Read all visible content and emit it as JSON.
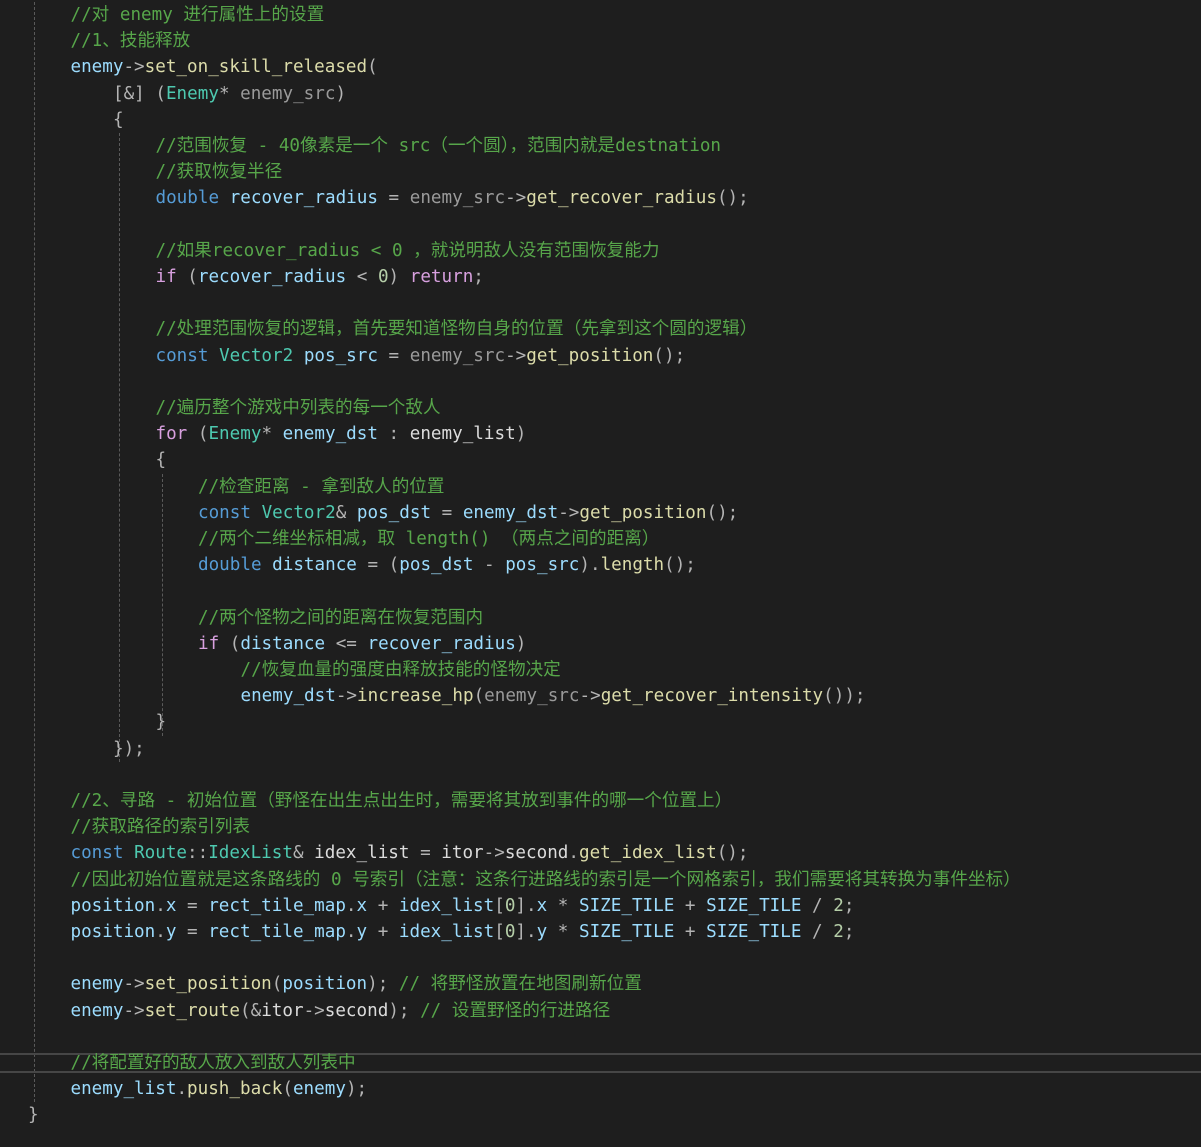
{
  "editor": {
    "theme_colors": {
      "background": "#1e1e1e",
      "comment": "#57a64a",
      "keyword": "#569cd6",
      "control": "#d8a0df",
      "type": "#4ec9b0",
      "function": "#dcdcaa",
      "variable": "#9cdcfe",
      "parameter": "#9a9a9a",
      "number": "#b5cea8",
      "macro": "#bd63c5",
      "identifier": "#dcdcdc",
      "punctuation": "#b4b4b4"
    },
    "lines": [
      {
        "indent": 1,
        "tokens": [
          {
            "t": "//对 enemy 进行属性上的设置",
            "k": "comment"
          }
        ]
      },
      {
        "indent": 1,
        "tokens": [
          {
            "t": "//1、技能释放",
            "k": "comment"
          }
        ]
      },
      {
        "indent": 1,
        "tokens": [
          {
            "t": "enemy",
            "k": "var"
          },
          {
            "t": "->",
            "k": "punct"
          },
          {
            "t": "set_on_skill_released",
            "k": "func"
          },
          {
            "t": "(",
            "k": "punct"
          }
        ]
      },
      {
        "indent": 2,
        "tokens": [
          {
            "t": "[&] (",
            "k": "punct"
          },
          {
            "t": "Enemy",
            "k": "type"
          },
          {
            "t": "* ",
            "k": "punct"
          },
          {
            "t": "enemy_src",
            "k": "param"
          },
          {
            "t": ")",
            "k": "punct"
          }
        ]
      },
      {
        "indent": 2,
        "tokens": [
          {
            "t": "{",
            "k": "punct"
          }
        ]
      },
      {
        "indent": 3,
        "tokens": [
          {
            "t": "//范围恢复 - 40像素是一个 src（一个圆），范围内就是destnation",
            "k": "comment"
          }
        ]
      },
      {
        "indent": 3,
        "tokens": [
          {
            "t": "//获取恢复半径",
            "k": "comment"
          }
        ]
      },
      {
        "indent": 3,
        "tokens": [
          {
            "t": "double",
            "k": "keyword"
          },
          {
            "t": " ",
            "k": "punct"
          },
          {
            "t": "recover_radius",
            "k": "var"
          },
          {
            "t": " = ",
            "k": "punct"
          },
          {
            "t": "enemy_src",
            "k": "param"
          },
          {
            "t": "->",
            "k": "punct"
          },
          {
            "t": "get_recover_radius",
            "k": "func"
          },
          {
            "t": "();",
            "k": "punct"
          }
        ]
      },
      {
        "indent": 3,
        "tokens": []
      },
      {
        "indent": 3,
        "tokens": [
          {
            "t": "//如果recover_radius < 0 ，就说明敌人没有范围恢复能力",
            "k": "comment"
          }
        ]
      },
      {
        "indent": 3,
        "tokens": [
          {
            "t": "if",
            "k": "control"
          },
          {
            "t": " (",
            "k": "punct"
          },
          {
            "t": "recover_radius",
            "k": "var"
          },
          {
            "t": " < ",
            "k": "punct"
          },
          {
            "t": "0",
            "k": "number"
          },
          {
            "t": ") ",
            "k": "punct"
          },
          {
            "t": "return",
            "k": "control"
          },
          {
            "t": ";",
            "k": "punct"
          }
        ]
      },
      {
        "indent": 3,
        "tokens": []
      },
      {
        "indent": 3,
        "tokens": [
          {
            "t": "//处理范围恢复的逻辑，首先要知道怪物自身的位置（先拿到这个圆的逻辑）",
            "k": "comment"
          }
        ]
      },
      {
        "indent": 3,
        "tokens": [
          {
            "t": "const",
            "k": "keyword"
          },
          {
            "t": " ",
            "k": "punct"
          },
          {
            "t": "Vector2",
            "k": "type"
          },
          {
            "t": " ",
            "k": "punct"
          },
          {
            "t": "pos_src",
            "k": "var"
          },
          {
            "t": " = ",
            "k": "punct"
          },
          {
            "t": "enemy_src",
            "k": "param"
          },
          {
            "t": "->",
            "k": "punct"
          },
          {
            "t": "get_position",
            "k": "func"
          },
          {
            "t": "();",
            "k": "punct"
          }
        ]
      },
      {
        "indent": 3,
        "tokens": []
      },
      {
        "indent": 3,
        "tokens": [
          {
            "t": "//遍历整个游戏中列表的每一个敌人",
            "k": "comment"
          }
        ]
      },
      {
        "indent": 3,
        "tokens": [
          {
            "t": "for",
            "k": "control"
          },
          {
            "t": " (",
            "k": "punct"
          },
          {
            "t": "Enemy",
            "k": "type"
          },
          {
            "t": "* ",
            "k": "punct"
          },
          {
            "t": "enemy_dst",
            "k": "var"
          },
          {
            "t": " : ",
            "k": "punct"
          },
          {
            "t": "enemy_list",
            "k": "ident"
          },
          {
            "t": ")",
            "k": "punct"
          }
        ]
      },
      {
        "indent": 3,
        "tokens": [
          {
            "t": "{",
            "k": "punct"
          }
        ]
      },
      {
        "indent": 4,
        "tokens": [
          {
            "t": "//检查距离 - 拿到敌人的位置",
            "k": "comment"
          }
        ]
      },
      {
        "indent": 4,
        "tokens": [
          {
            "t": "const",
            "k": "keyword"
          },
          {
            "t": " ",
            "k": "punct"
          },
          {
            "t": "Vector2",
            "k": "type"
          },
          {
            "t": "& ",
            "k": "punct"
          },
          {
            "t": "pos_dst",
            "k": "var"
          },
          {
            "t": " = ",
            "k": "punct"
          },
          {
            "t": "enemy_dst",
            "k": "var"
          },
          {
            "t": "->",
            "k": "punct"
          },
          {
            "t": "get_position",
            "k": "func"
          },
          {
            "t": "();",
            "k": "punct"
          }
        ]
      },
      {
        "indent": 4,
        "tokens": [
          {
            "t": "//两个二维坐标相减，取 length() （两点之间的距离）",
            "k": "comment"
          }
        ]
      },
      {
        "indent": 4,
        "tokens": [
          {
            "t": "double",
            "k": "keyword"
          },
          {
            "t": " ",
            "k": "punct"
          },
          {
            "t": "distance",
            "k": "var"
          },
          {
            "t": " = (",
            "k": "punct"
          },
          {
            "t": "pos_dst",
            "k": "var"
          },
          {
            "t": " - ",
            "k": "punct"
          },
          {
            "t": "pos_src",
            "k": "var"
          },
          {
            "t": ").",
            "k": "punct"
          },
          {
            "t": "length",
            "k": "func"
          },
          {
            "t": "();",
            "k": "punct"
          }
        ]
      },
      {
        "indent": 4,
        "tokens": []
      },
      {
        "indent": 4,
        "tokens": [
          {
            "t": "//两个怪物之间的距离在恢复范围内",
            "k": "comment"
          }
        ]
      },
      {
        "indent": 4,
        "tokens": [
          {
            "t": "if",
            "k": "control"
          },
          {
            "t": " (",
            "k": "punct"
          },
          {
            "t": "distance",
            "k": "var"
          },
          {
            "t": " <= ",
            "k": "punct"
          },
          {
            "t": "recover_radius",
            "k": "var"
          },
          {
            "t": ")",
            "k": "punct"
          }
        ]
      },
      {
        "indent": 5,
        "tokens": [
          {
            "t": "//恢复血量的强度由释放技能的怪物决定",
            "k": "comment"
          }
        ]
      },
      {
        "indent": 5,
        "tokens": [
          {
            "t": "enemy_dst",
            "k": "var"
          },
          {
            "t": "->",
            "k": "punct"
          },
          {
            "t": "increase_hp",
            "k": "func"
          },
          {
            "t": "(",
            "k": "punct"
          },
          {
            "t": "enemy_src",
            "k": "param"
          },
          {
            "t": "->",
            "k": "punct"
          },
          {
            "t": "get_recover_intensity",
            "k": "func"
          },
          {
            "t": "());",
            "k": "punct"
          }
        ]
      },
      {
        "indent": 3,
        "tokens": [
          {
            "t": "}",
            "k": "punct"
          }
        ]
      },
      {
        "indent": 2,
        "tokens": [
          {
            "t": "});",
            "k": "punct"
          }
        ]
      },
      {
        "indent": 1,
        "tokens": []
      },
      {
        "indent": 1,
        "tokens": [
          {
            "t": "//2、寻路 - 初始位置（野怪在出生点出生时，需要将其放到事件的哪一个位置上）",
            "k": "comment"
          }
        ]
      },
      {
        "indent": 1,
        "tokens": [
          {
            "t": "//获取路径的索引列表",
            "k": "comment"
          }
        ]
      },
      {
        "indent": 1,
        "tokens": [
          {
            "t": "const",
            "k": "keyword"
          },
          {
            "t": " ",
            "k": "punct"
          },
          {
            "t": "Route",
            "k": "type"
          },
          {
            "t": "::",
            "k": "punct"
          },
          {
            "t": "IdexList",
            "k": "type"
          },
          {
            "t": "& ",
            "k": "punct"
          },
          {
            "t": "idex_list",
            "k": "ident"
          },
          {
            "t": " = ",
            "k": "punct"
          },
          {
            "t": "itor",
            "k": "ident"
          },
          {
            "t": "->",
            "k": "punct"
          },
          {
            "t": "second",
            "k": "ident"
          },
          {
            "t": ".",
            "k": "punct"
          },
          {
            "t": "get_idex_list",
            "k": "func"
          },
          {
            "t": "();",
            "k": "punct"
          }
        ]
      },
      {
        "indent": 1,
        "tokens": [
          {
            "t": "//因此初始位置就是这条路线的 0 号索引（注意：这条行进路线的索引是一个网格索引，我们需要将其转换为事件坐标）",
            "k": "comment"
          }
        ]
      },
      {
        "indent": 1,
        "tokens": [
          {
            "t": "position",
            "k": "var"
          },
          {
            "t": ".",
            "k": "punct"
          },
          {
            "t": "x",
            "k": "var"
          },
          {
            "t": " = ",
            "k": "punct"
          },
          {
            "t": "rect_tile_map",
            "k": "var"
          },
          {
            "t": ".",
            "k": "punct"
          },
          {
            "t": "x",
            "k": "var"
          },
          {
            "t": " + ",
            "k": "punct"
          },
          {
            "t": "idex_list",
            "k": "var"
          },
          {
            "t": "[",
            "k": "punct"
          },
          {
            "t": "0",
            "k": "number"
          },
          {
            "t": "].",
            "k": "punct"
          },
          {
            "t": "x",
            "k": "var"
          },
          {
            "t": " * ",
            "k": "punct"
          },
          {
            "t": "SIZE_TILE",
            "k": "var"
          },
          {
            "t": " + ",
            "k": "punct"
          },
          {
            "t": "SIZE_TILE",
            "k": "var"
          },
          {
            "t": " / ",
            "k": "punct"
          },
          {
            "t": "2",
            "k": "number"
          },
          {
            "t": ";",
            "k": "punct"
          }
        ]
      },
      {
        "indent": 1,
        "tokens": [
          {
            "t": "position",
            "k": "var"
          },
          {
            "t": ".",
            "k": "punct"
          },
          {
            "t": "y",
            "k": "var"
          },
          {
            "t": " = ",
            "k": "punct"
          },
          {
            "t": "rect_tile_map",
            "k": "var"
          },
          {
            "t": ".",
            "k": "punct"
          },
          {
            "t": "y",
            "k": "var"
          },
          {
            "t": " + ",
            "k": "punct"
          },
          {
            "t": "idex_list",
            "k": "var"
          },
          {
            "t": "[",
            "k": "punct"
          },
          {
            "t": "0",
            "k": "number"
          },
          {
            "t": "].",
            "k": "punct"
          },
          {
            "t": "y",
            "k": "var"
          },
          {
            "t": " * ",
            "k": "punct"
          },
          {
            "t": "SIZE_TILE",
            "k": "var"
          },
          {
            "t": " + ",
            "k": "punct"
          },
          {
            "t": "SIZE_TILE",
            "k": "var"
          },
          {
            "t": " / ",
            "k": "punct"
          },
          {
            "t": "2",
            "k": "number"
          },
          {
            "t": ";",
            "k": "punct"
          }
        ]
      },
      {
        "indent": 1,
        "tokens": []
      },
      {
        "indent": 1,
        "tokens": [
          {
            "t": "enemy",
            "k": "var"
          },
          {
            "t": "->",
            "k": "punct"
          },
          {
            "t": "set_position",
            "k": "func"
          },
          {
            "t": "(",
            "k": "punct"
          },
          {
            "t": "position",
            "k": "var"
          },
          {
            "t": "); ",
            "k": "punct"
          },
          {
            "t": "// 将野怪放置在地图刷新位置",
            "k": "comment"
          }
        ]
      },
      {
        "indent": 1,
        "tokens": [
          {
            "t": "enemy",
            "k": "var"
          },
          {
            "t": "->",
            "k": "punct"
          },
          {
            "t": "set_route",
            "k": "func"
          },
          {
            "t": "(&",
            "k": "punct"
          },
          {
            "t": "itor",
            "k": "ident"
          },
          {
            "t": "->",
            "k": "punct"
          },
          {
            "t": "second",
            "k": "ident"
          },
          {
            "t": "); ",
            "k": "punct"
          },
          {
            "t": "// 设置野怪的行进路径",
            "k": "comment"
          }
        ]
      },
      {
        "indent": 1,
        "tokens": []
      },
      {
        "indent": 1,
        "tokens": [
          {
            "t": "//将配置好的敌人放入到敌人列表中",
            "k": "comment"
          }
        ]
      },
      {
        "indent": 1,
        "tokens": [
          {
            "t": "enemy_list",
            "k": "var"
          },
          {
            "t": ".",
            "k": "punct"
          },
          {
            "t": "push_back",
            "k": "func"
          },
          {
            "t": "(",
            "k": "punct"
          },
          {
            "t": "enemy",
            "k": "var"
          },
          {
            "t": ");",
            "k": "punct"
          }
        ]
      },
      {
        "indent": 0,
        "tokens": [
          {
            "t": "}",
            "k": "punct"
          }
        ]
      }
    ]
  }
}
